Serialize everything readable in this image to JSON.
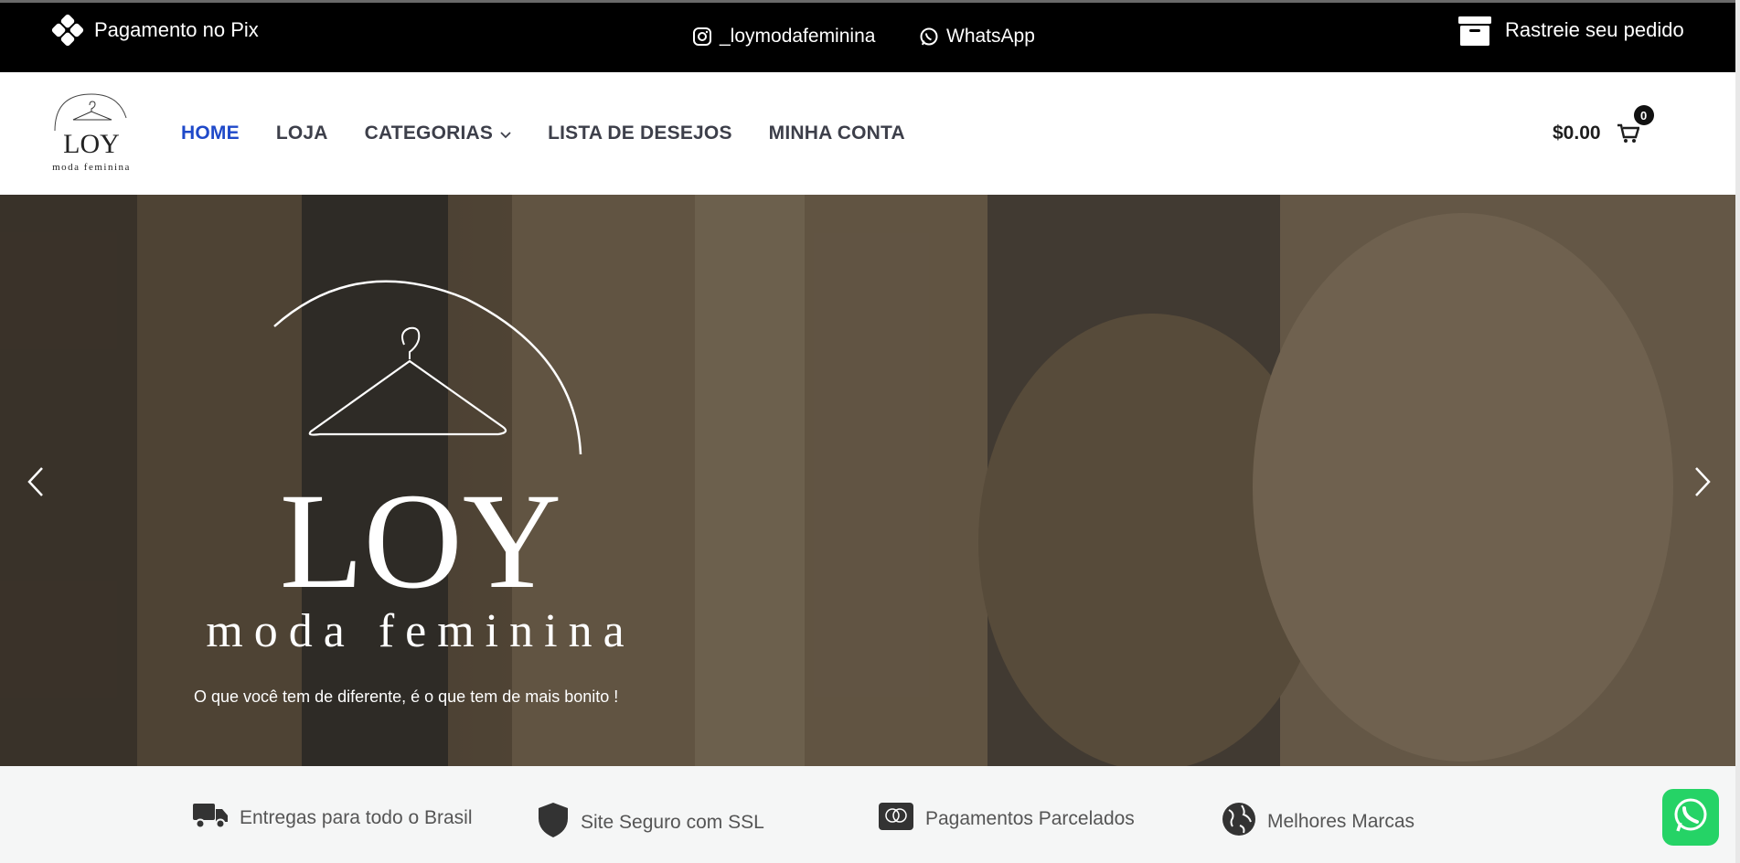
{
  "topbar": {
    "pix_label": "Pagamento no Pix",
    "instagram_label": "_loymodafeminina",
    "whatsapp_label": "WhatsApp",
    "track_label": "Rastreie seu pedido"
  },
  "brand": {
    "logo_word": "LOY",
    "logo_sub": "moda feminina"
  },
  "nav": {
    "items": [
      {
        "label": "HOME",
        "active": true
      },
      {
        "label": "LOJA"
      },
      {
        "label": "CATEGORIAS"
      },
      {
        "label": "LISTA DE DESEJOS"
      },
      {
        "label": "MINHA CONTA"
      }
    ]
  },
  "cart": {
    "total": "$0.00",
    "count": "0"
  },
  "hero": {
    "logo_word": "LOY",
    "logo_sub": "moda feminina",
    "tagline": "O que você tem de diferente, é o que tem de mais bonito !"
  },
  "features": [
    {
      "label": "Entregas para todo o Brasil",
      "icon": "truck-icon"
    },
    {
      "label": "Site Seguro com SSL",
      "icon": "shield-icon"
    },
    {
      "label": "Pagamentos Parcelados",
      "icon": "credit-card-icon"
    },
    {
      "label": "Melhores Marcas",
      "icon": "globe-icon"
    }
  ],
  "colors": {
    "accent": "#1f49c9",
    "topbar": "#000000",
    "whatsapp": "#25d366"
  }
}
